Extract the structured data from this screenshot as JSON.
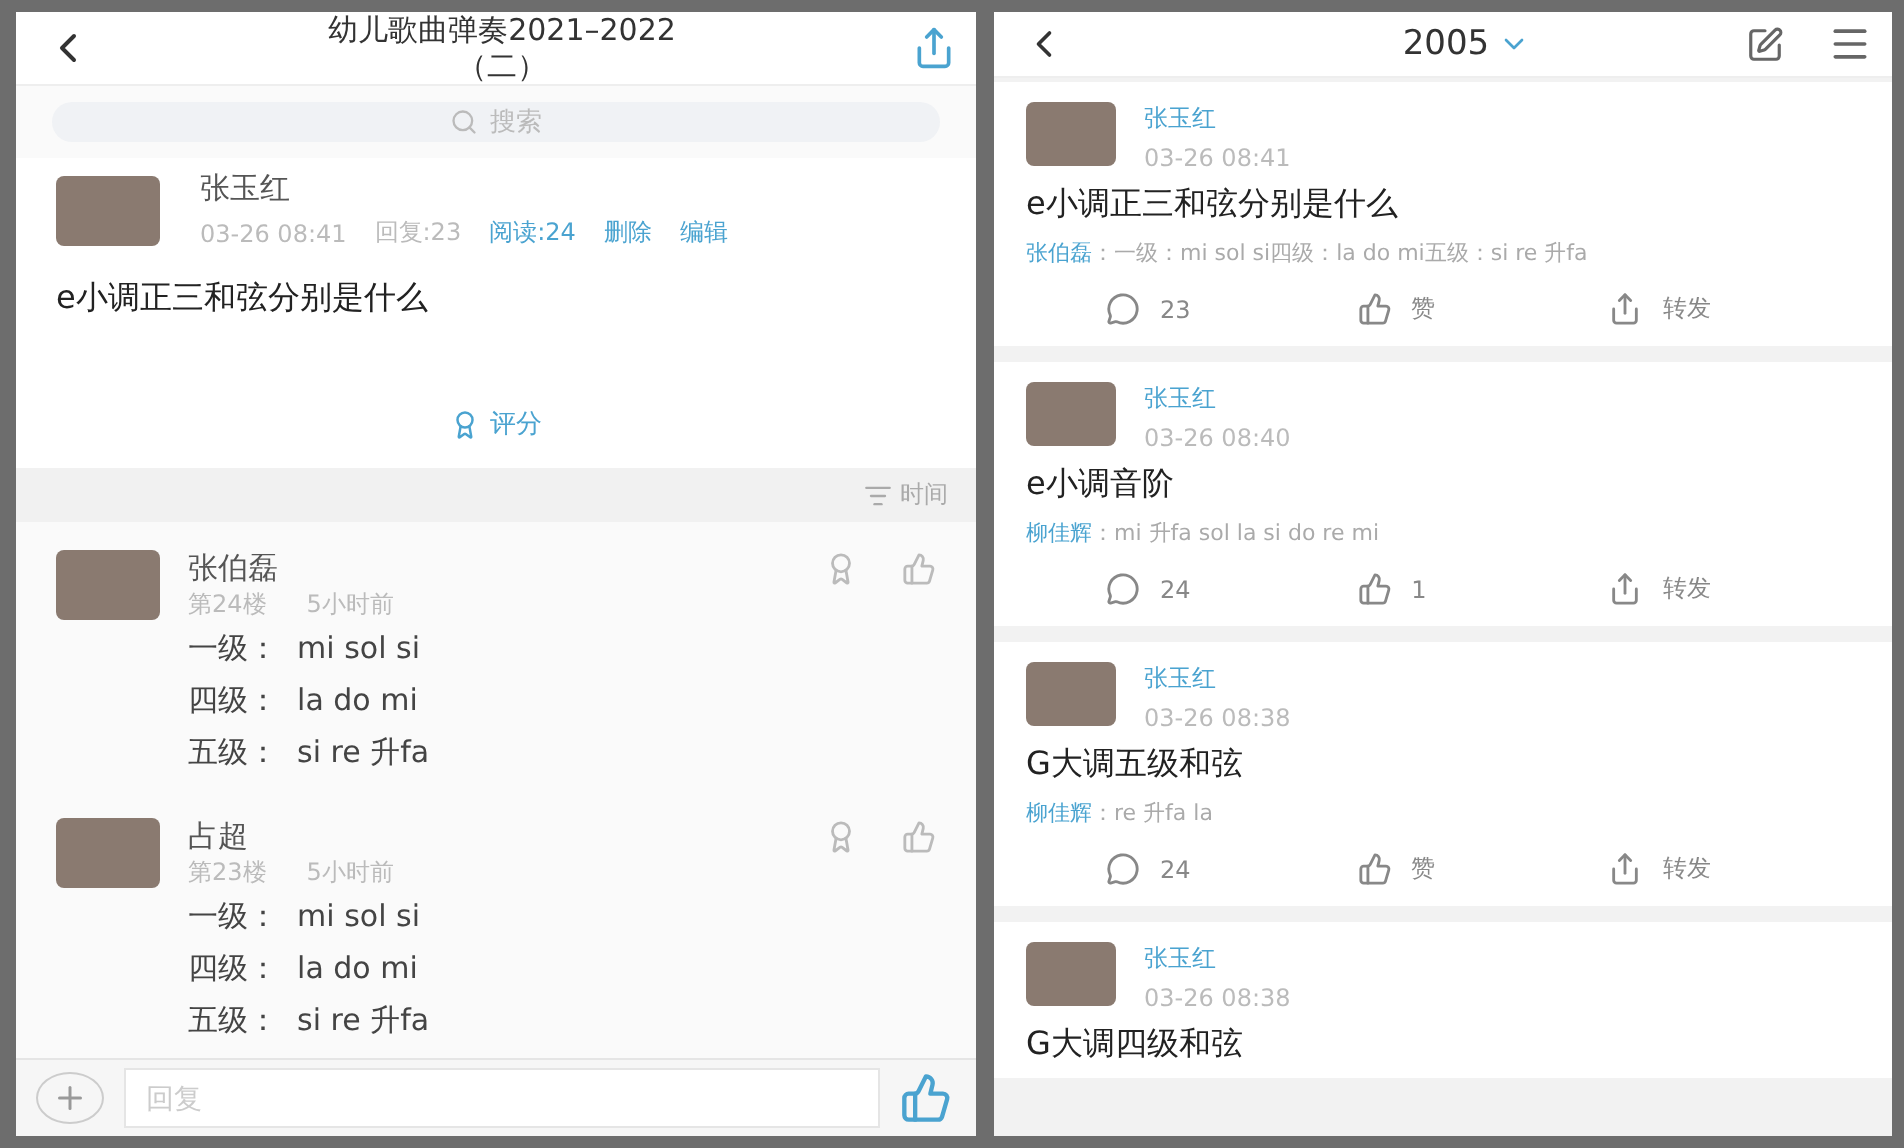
{
  "left": {
    "title_lines": [
      "幼儿歌曲弹奏2021–2022",
      "（二）"
    ],
    "search": {
      "placeholder": "搜索"
    },
    "post": {
      "author": "张玉红",
      "time": "03-26 08:41",
      "replies": "回复:23",
      "reads": "阅读:24",
      "actions": [
        "删除",
        "编辑"
      ],
      "question": "e小调正三和弦分别是什么",
      "rate": "评分"
    },
    "sort": "时间",
    "comments": [
      {
        "name": "张伯磊",
        "floor": "第24楼",
        "ago": "5小时前",
        "lines": [
          "一级：  mi sol si",
          "四级：  la do mi",
          "五级：  si re 升fa"
        ]
      },
      {
        "name": "占超",
        "floor": "第23楼",
        "ago": "5小时前",
        "lines": [
          "一级：  mi sol si",
          "四级：  la do mi",
          "五级：  si re 升fa"
        ]
      }
    ],
    "reply": {
      "placeholder": "回复"
    }
  },
  "right": {
    "title": "2005",
    "posts": [
      {
        "author": "张玉红",
        "time": "03-26 08:41",
        "title": "e小调正三和弦分别是什么",
        "reply": {
          "name": "张伯磊",
          "text": "：一级：mi sol si四级：la do mi五级：si re 升fa"
        },
        "comments": "23",
        "likes": "赞",
        "share": "转发"
      },
      {
        "author": "张玉红",
        "time": "03-26 08:40",
        "title": "e小调音阶",
        "reply": {
          "name": "柳佳辉",
          "text": "：mi 升fa sol la si do re mi"
        },
        "comments": "24",
        "likes": "1",
        "share": "转发"
      },
      {
        "author": "张玉红",
        "time": "03-26 08:38",
        "title": "G大调五级和弦",
        "reply": {
          "name": "柳佳辉",
          "text": "：re 升fa la"
        },
        "comments": "24",
        "likes": "赞",
        "share": "转发"
      },
      {
        "author": "张玉红",
        "time": "03-26 08:38",
        "title": "G大调四级和弦"
      }
    ]
  }
}
